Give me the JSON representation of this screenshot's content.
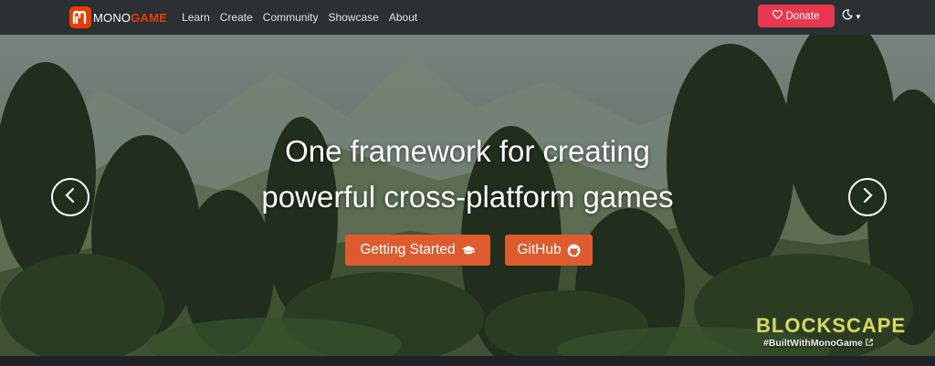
{
  "navbar": {
    "brand_mono": "MONO",
    "brand_game": "GAME",
    "links": [
      "Learn",
      "Create",
      "Community",
      "Showcase",
      "About"
    ],
    "donate_label": "Donate"
  },
  "hero": {
    "headline_line1": "One framework for creating",
    "headline_line2": "powerful cross-platform games",
    "getting_started_label": "Getting Started",
    "github_label": "GitHub",
    "credit_game": "BLOCKSCAPE",
    "credit_tag": "#BuiltWithMonoGame"
  },
  "icons": {
    "theme": "moon-icon",
    "donate": "heart-icon",
    "getting_started": "graduation-cap-icon",
    "github": "github-icon",
    "prev": "chevron-left-icon",
    "next": "chevron-right-icon",
    "external": "external-link-icon"
  },
  "colors": {
    "navbar_bg": "#2b3035",
    "brand_accent": "#e73c00",
    "donate_bg": "#e8374f",
    "cta_bg": "#dd5b2e"
  }
}
